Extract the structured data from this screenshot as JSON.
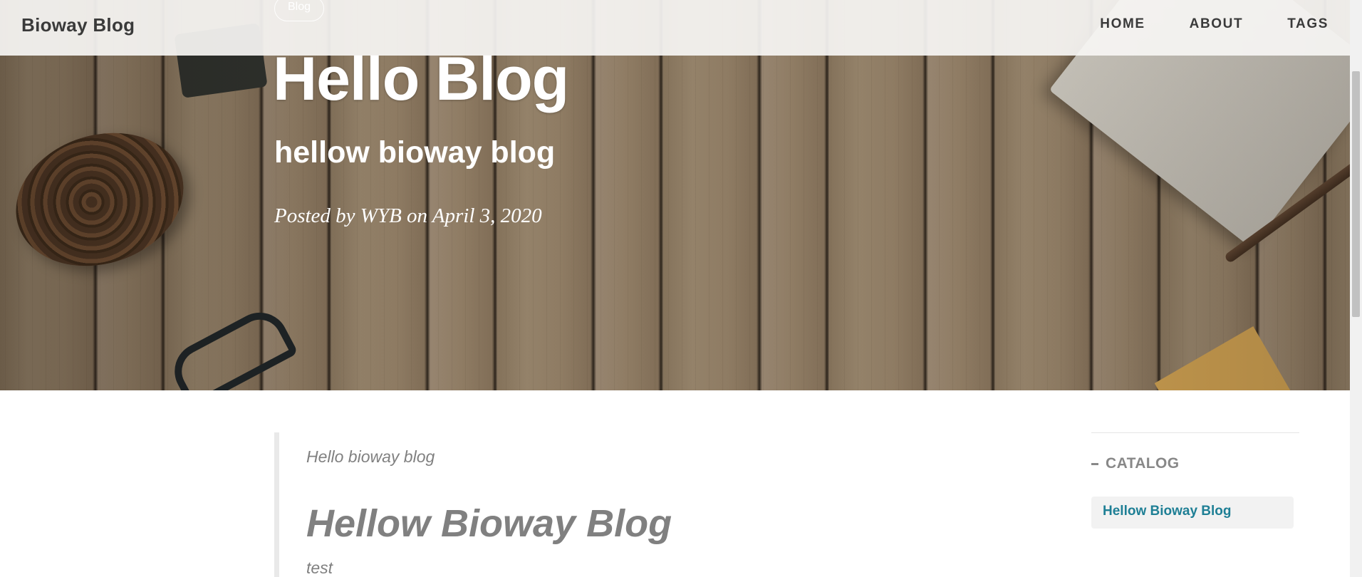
{
  "navbar": {
    "brand": "Bioway Blog",
    "links": [
      "HOME",
      "ABOUT",
      "TAGS"
    ]
  },
  "post": {
    "tag": "Blog",
    "title": "Hello Blog",
    "subtitle": "hellow bioway blog",
    "meta": "Posted by WYB on April 3, 2020"
  },
  "article": {
    "quote": "Hello bioway blog",
    "heading": "Hellow Bioway Blog",
    "text": "test"
  },
  "catalog": {
    "title": "CATALOG",
    "items": [
      "Hellow Bioway Blog"
    ],
    "link_color": "#1e7f95"
  },
  "icons": {
    "collapse": "minus-icon"
  }
}
